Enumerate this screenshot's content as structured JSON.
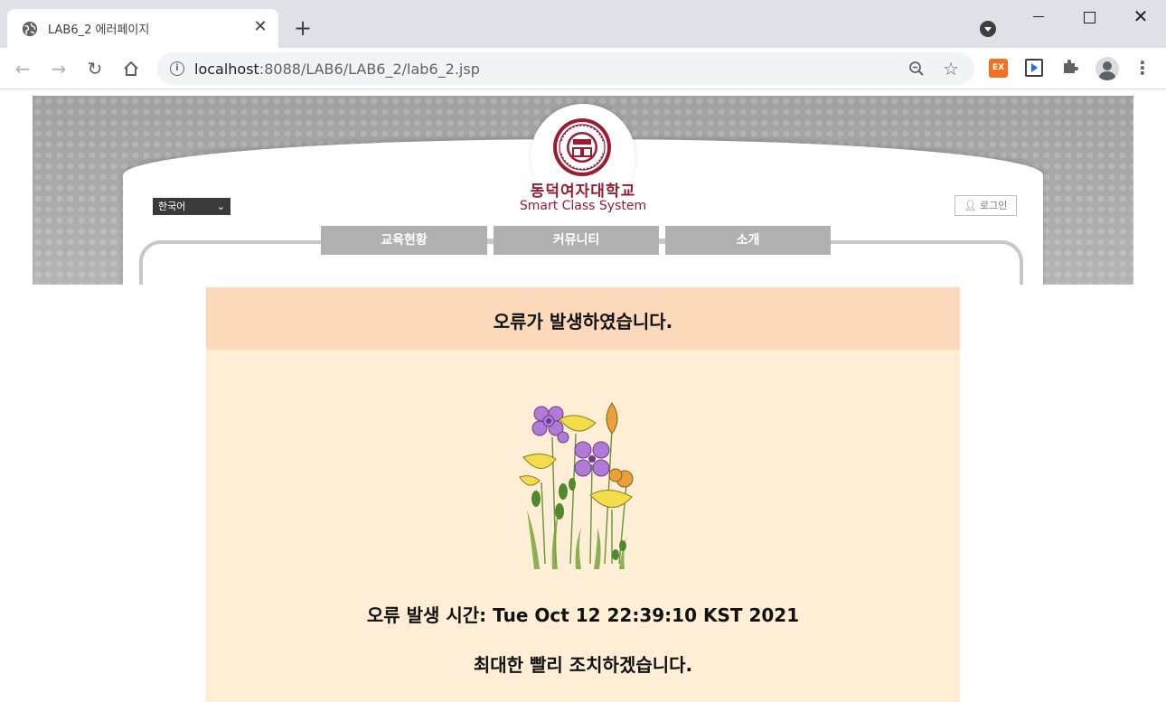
{
  "browser": {
    "tab_title": "LAB6_2 에러페이지",
    "tab_close": "✕",
    "new_tab": "+",
    "window_close": "✕",
    "url_host": "localhost",
    "url_path": ":8088/LAB6/LAB6_2/lab6_2.jsp",
    "extension_ex_label": "EX",
    "icons": [
      "globe-icon",
      "back-arrow-icon",
      "forward-arrow-icon",
      "reload-icon",
      "home-icon",
      "info-icon",
      "zoom-icon",
      "star-icon",
      "puzzle-icon",
      "profile-icon",
      "kebab-menu-icon"
    ]
  },
  "banner": {
    "univ_name": "동덕여자대학교",
    "univ_sub": "Smart Class System",
    "language": "한국어",
    "login": "로그인",
    "menu": [
      "교육현황",
      "커뮤니티",
      "소개"
    ]
  },
  "error": {
    "title": "오류가 발생하였습니다.",
    "time_line": "오류 발생 시간: Tue Oct 12 22:39:10 KST 2021",
    "message": "최대한 빨리 조치하겠습니다."
  },
  "colors": {
    "header_bg": "#fcd9bb",
    "body_bg": "#feeed6",
    "brand": "#9b1b30",
    "nav_button": "#b0b0b0"
  }
}
